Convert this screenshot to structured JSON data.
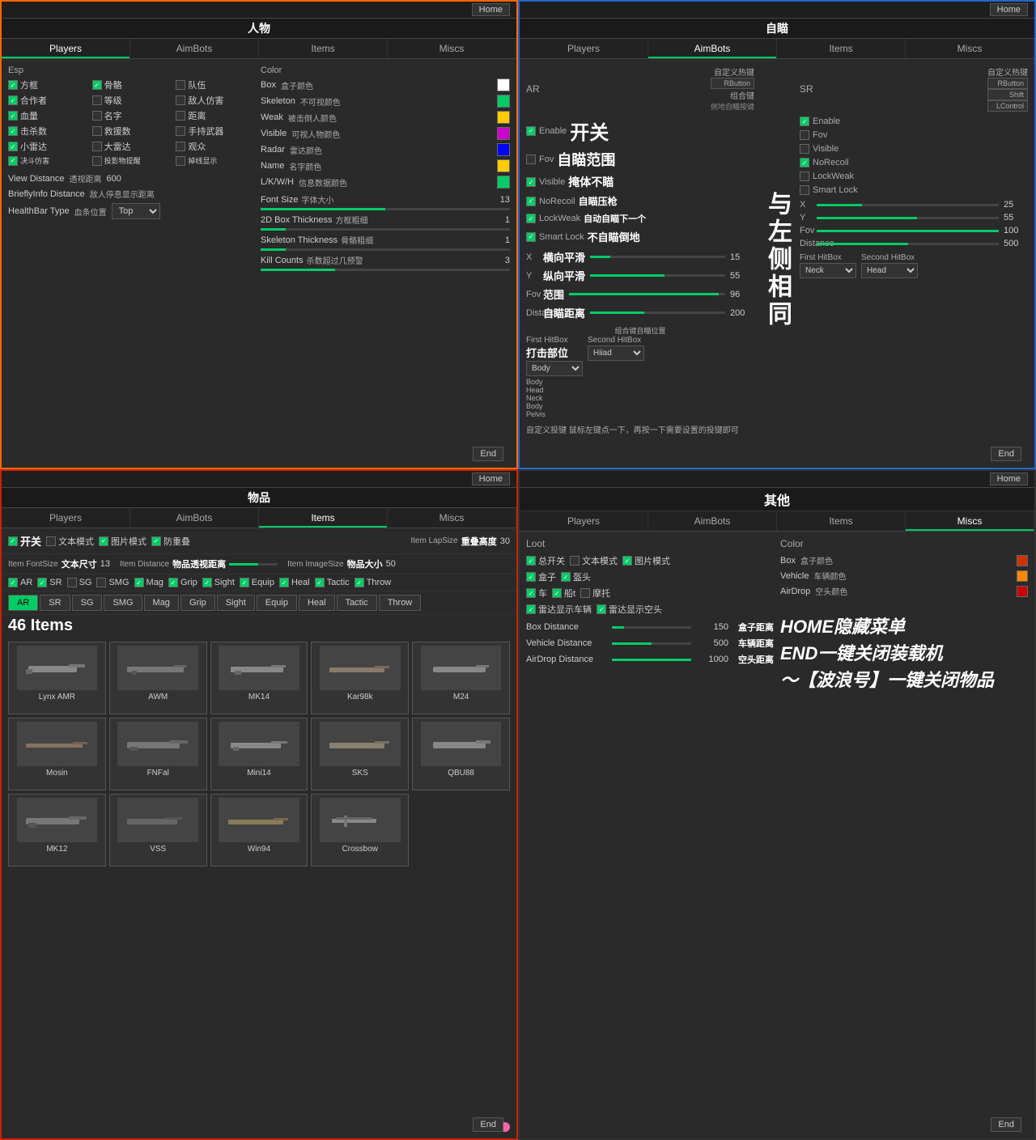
{
  "panels": {
    "p1": {
      "title": "人物",
      "tabs": [
        "Players",
        "AimBots",
        "Items",
        "Miscs"
      ],
      "active_tab": "Players",
      "home_btn": "Home",
      "esp_label": "Esp",
      "color_label": "Color",
      "checkboxes": [
        {
          "label": "方框",
          "checked": true
        },
        {
          "label": "骨骼",
          "checked": true
        },
        {
          "label": "队伍",
          "checked": false
        },
        {
          "label": "合作者",
          "checked": true
        },
        {
          "label": "等级",
          "checked": false
        },
        {
          "label": "敌人仿害",
          "checked": false
        },
        {
          "label": "血量",
          "checked": true
        },
        {
          "label": "名字",
          "checked": false
        },
        {
          "label": "距离",
          "checked": false
        },
        {
          "label": "击杀数",
          "checked": true
        },
        {
          "label": "救援数",
          "checked": false
        },
        {
          "label": "手持武器",
          "checked": false
        },
        {
          "label": "小雷达",
          "checked": true
        },
        {
          "label": "大雷达",
          "checked": false
        },
        {
          "label": "观众",
          "checked": false
        },
        {
          "label": "决斗仿害",
          "checked": true
        },
        {
          "label": "投影物提醒",
          "checked": false
        },
        {
          "label": "掉线显示",
          "checked": false
        }
      ],
      "sliders": [
        {
          "label": "透视距离 View Distance",
          "value": 600
        },
        {
          "label": "敌人停息显示距离 BrieflyInfo Distance",
          "value": ""
        },
        {
          "label": "血条位置 HealthBar Type",
          "value": "Top"
        }
      ],
      "colors": [
        {
          "label": "Box",
          "cn": "盒子颜色",
          "color": "#ffffff"
        },
        {
          "label": "Skeleton",
          "cn": "不可视颜色",
          "color": "#00cc66"
        },
        {
          "label": "Weak",
          "cn": "被击倒人颜色",
          "color": "#ffcc00"
        },
        {
          "label": "Visible",
          "cn": "可视人物颜色",
          "color": "#cc00cc"
        },
        {
          "label": "Radar",
          "cn": "雷达颜色",
          "color": "#0000ff"
        },
        {
          "label": "Name",
          "cn": "名字颜色",
          "color": "#ffcc00"
        },
        {
          "label": "L/K/W/H",
          "cn": "信息数据颜色",
          "color": "#00cc66"
        }
      ],
      "font_size": {
        "label": "Font Size",
        "cn": "字体大小",
        "value": 13
      },
      "box_thickness": {
        "label": "2D Box Thickness",
        "cn": "方框粗细",
        "value": 1
      },
      "skeleton_thickness": {
        "label": "Skeleton Thickness",
        "cn": "骨骼粗细",
        "value": 1
      },
      "kill_counts": {
        "label": "Kill Counts",
        "cn": "杀数超过几预警",
        "value": 3
      },
      "end_btn": "End"
    },
    "p2": {
      "title": "自瞄",
      "tabs": [
        "Players",
        "AimBots",
        "Items",
        "Miscs"
      ],
      "active_tab": "AimBots",
      "home_btn": "Home",
      "ar_label": "AR",
      "sr_label": "SR",
      "custom_hotkey": "自定义热键",
      "ar_settings": {
        "enable": {
          "label": "Enable",
          "cn": "开关",
          "checked": true
        },
        "fov": {
          "label": "Fov",
          "cn": "自瞄范围",
          "checked": false
        },
        "visible": {
          "label": "Visible",
          "cn": "掩体不瞄",
          "checked": true
        },
        "norecoil": {
          "label": "NoRecoil",
          "cn": "自瞄压枪",
          "checked": true
        },
        "lockweak": {
          "label": "LockWeak",
          "cn": "自动自瞄下一个",
          "checked": true
        },
        "smartlock": {
          "label": "Smart Lock",
          "cn": "不自瞄倒地",
          "checked": true
        },
        "x": {
          "label": "X",
          "cn": "横向平滑",
          "value": 15
        },
        "y": {
          "label": "Y",
          "cn": "纵向平滑",
          "value": 55
        },
        "fov_val": {
          "label": "Fov",
          "cn": "范围",
          "value": 96
        },
        "distance": {
          "label": "Distance",
          "cn": "自瞄距离",
          "value": 200
        },
        "hitbox1": "Body",
        "hitbox2": "Hiiad",
        "hitbox_options": [
          "Body",
          "Head",
          "Neck",
          "Body",
          "Pelvis"
        ]
      },
      "sr_settings": {
        "enable": {
          "label": "Enable",
          "checked": true
        },
        "fov": {
          "label": "Fov",
          "checked": false
        },
        "visible": {
          "label": "Visible",
          "checked": false
        },
        "norecoil": {
          "label": "NoRecoil",
          "checked": true
        },
        "lockweak": {
          "label": "LockWeak",
          "checked": false
        },
        "smartlock": {
          "label": "Smart Lock",
          "checked": false
        },
        "x": {
          "label": "X",
          "value": 25
        },
        "y": {
          "label": "Y",
          "value": 55
        },
        "fov_val": {
          "label": "Fov",
          "value": 100
        },
        "distance": {
          "label": "Distance",
          "value": 500
        },
        "hitbox1": "Neck",
        "hitbox2": "Head"
      },
      "side_cn": "与左侧相同",
      "combo_cn": "组合键自瞄位置",
      "hotkey_note": "自定义投键 鼠标左键点一下，再按一下需要设置的投键即可",
      "hotkeys": {
        "rbtn": "RButton",
        "shift": "Shift",
        "lcontrol": "LControl"
      },
      "end_btn": "End"
    },
    "p3": {
      "title": "物品",
      "tabs": [
        "Players",
        "AimBots",
        "Items",
        "Miscs"
      ],
      "active_tab": "Items",
      "home_btn": "Home",
      "enable_cn": "开关",
      "text_mode": "文本模式",
      "img_mode": "图片模式",
      "anti_repeat": "防重叠",
      "item_lapsize": {
        "label": "Item LapSize",
        "cn": "重叠高度",
        "value": 30
      },
      "item_fontsize": {
        "label": "Item FontSize",
        "cn": "文本尺寸",
        "value": 13
      },
      "item_distance": {
        "label": "Item Distance",
        "cn": "物品透视距离"
      },
      "item_imagesize": {
        "label": "Item ImageSize",
        "cn": "物品大小",
        "value": 50
      },
      "count_label": "46 Items",
      "checkboxes": [
        {
          "label": "AR",
          "checked": true
        },
        {
          "label": "SR",
          "checked": true
        },
        {
          "label": "SG",
          "checked": false
        },
        {
          "label": "SMG",
          "checked": false
        },
        {
          "label": "Mag",
          "checked": true
        },
        {
          "label": "Grip",
          "checked": true
        },
        {
          "label": "Sight",
          "checked": true
        },
        {
          "label": "Equip",
          "checked": true
        },
        {
          "label": "Heal",
          "checked": true
        },
        {
          "label": "Tactic",
          "checked": true
        },
        {
          "label": "Throw",
          "checked": true
        }
      ],
      "cat_tabs": [
        "AR",
        "SR",
        "SG",
        "SMG",
        "Mag",
        "Grip",
        "Sight",
        "Equip",
        "Heal",
        "Tactic",
        "Throw"
      ],
      "active_cat": "AR",
      "guns": [
        {
          "name": "Lynx AMR"
        },
        {
          "name": "AWM"
        },
        {
          "name": "MK14"
        },
        {
          "name": "Kar98k"
        },
        {
          "name": "M24"
        },
        {
          "name": "Mosin"
        },
        {
          "name": "FNFal"
        },
        {
          "name": "Mini14"
        },
        {
          "name": "SKS"
        },
        {
          "name": "QBU88"
        },
        {
          "name": "MK12"
        },
        {
          "name": "VSS"
        },
        {
          "name": "Win94"
        },
        {
          "name": "Crossbow"
        }
      ],
      "end_btn": "End"
    },
    "p4": {
      "title": "其他",
      "tabs": [
        "Players",
        "AimBots",
        "Items",
        "Miscs"
      ],
      "active_tab": "Miscs",
      "home_btn": "Home",
      "loot_label": "Loot",
      "color_label": "Color",
      "checkboxes": [
        {
          "label": "总开关",
          "checked": true
        },
        {
          "label": "文本模式",
          "checked": false
        },
        {
          "label": "图片模式",
          "checked": true
        },
        {
          "label": "盒子",
          "checked": true
        },
        {
          "label": "盔头",
          "checked": true
        },
        {
          "label": "车",
          "checked": true
        },
        {
          "label": "船t",
          "checked": true
        },
        {
          "label": "摩托",
          "checked": false
        },
        {
          "label": "雷达显示车辆",
          "checked": true
        },
        {
          "label": "雷达显示空头",
          "checked": true
        }
      ],
      "colors": [
        {
          "label": "Box",
          "cn": "盒子颜色",
          "color": "#cc3300"
        },
        {
          "label": "Vehicle",
          "cn": "车辆颜色",
          "color": "#ff8800"
        },
        {
          "label": "AirDrop",
          "cn": "空头颜色",
          "color": "#cc0000"
        }
      ],
      "sliders": [
        {
          "label": "Box Distance",
          "cn": "盒子距离",
          "value": 150
        },
        {
          "label": "Vehicle Distance",
          "cn": "车辆距离",
          "value": 500
        },
        {
          "label": "AirDrop Distance",
          "cn": "空头距离",
          "value": 1000
        }
      ],
      "big_text": [
        "HOME隐藏菜单",
        "END一键关闭装载机",
        "～【波浪号】一键关闭物品"
      ],
      "end_btn": "End"
    }
  }
}
